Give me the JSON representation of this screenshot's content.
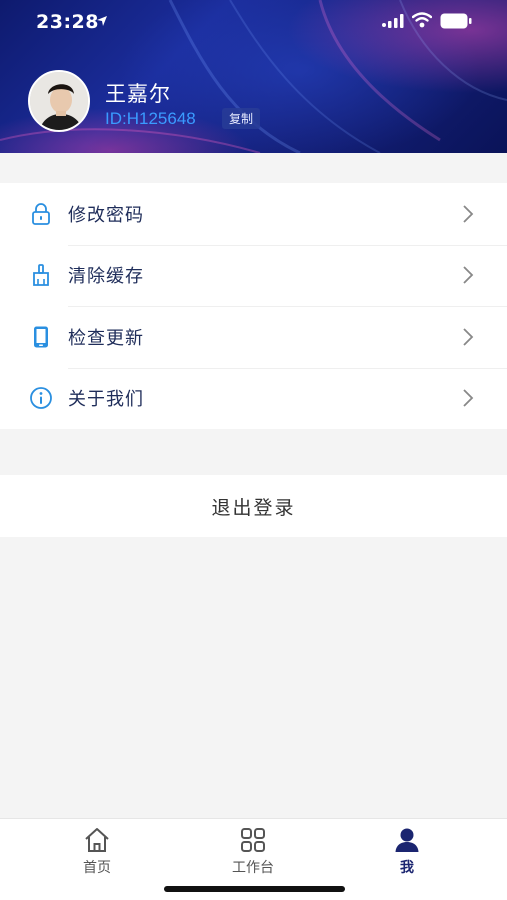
{
  "status_bar": {
    "time": "23:28",
    "icons": [
      "location-arrow-icon",
      "cellular-signal-icon",
      "wifi-icon",
      "battery-icon"
    ]
  },
  "profile": {
    "name": "王嘉尔",
    "id": "ID:H125648",
    "copy_label": "复制",
    "avatar": "avatar-photo"
  },
  "menu": {
    "items": [
      {
        "label": "修改密码",
        "icon": "lock-icon"
      },
      {
        "label": "清除缓存",
        "icon": "broom-icon"
      },
      {
        "label": "检查更新",
        "icon": "phone-icon"
      },
      {
        "label": "关于我们",
        "icon": "info-icon"
      }
    ],
    "chevron": "chevron-right-icon"
  },
  "logout": {
    "label": "退出登录"
  },
  "tabbar": {
    "tabs": [
      {
        "label": "首页",
        "icon": "home-icon",
        "active": false
      },
      {
        "label": "工作台",
        "icon": "grid-icon",
        "active": false
      },
      {
        "label": "我",
        "icon": "user-icon",
        "active": true
      }
    ]
  },
  "colors": {
    "header_bg": "#14207a",
    "accent_blue": "#3a9bff",
    "menu_icon": "#2a8fe0",
    "active_tab": "#1b2570",
    "page_bg": "#f4f4f4"
  }
}
